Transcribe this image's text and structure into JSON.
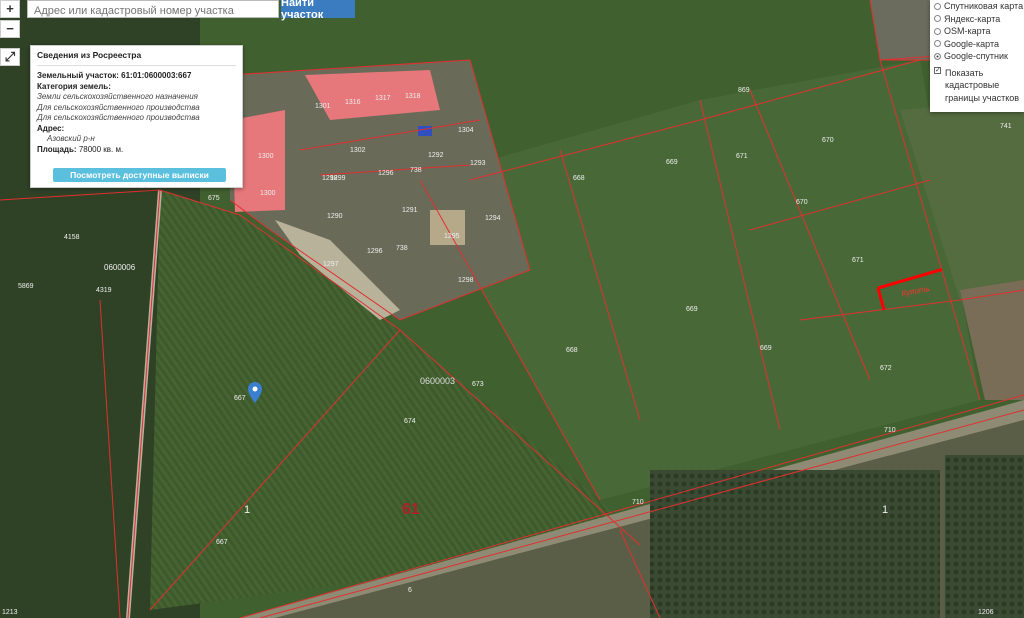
{
  "search": {
    "placeholder": "Адрес или кадастровый номер участка",
    "button": "Найти участок"
  },
  "zoom": {
    "in": "+",
    "out": "−",
    "fullscreen": "⤢"
  },
  "info_panel": {
    "title": "Сведения из Росреестра",
    "parcel_label": "Земельный участок:",
    "parcel_value": "61:01:0600003:667",
    "category_label": "Категория земель:",
    "category_value": "Земли сельскохозяйственного назначения",
    "usage_1": "Для сельскохозяйственного производства",
    "usage_2": "Для сельскохозяйственного производства",
    "address_label": "Адрес:",
    "address_value": "Азовский р-н",
    "area_label": "Площадь:",
    "area_value": "78000 кв. м.",
    "button": "Посмотреть доступные выписки"
  },
  "layers": {
    "options": [
      {
        "label": "Спутниковая карта",
        "selected": false
      },
      {
        "label": "Яндекс-карта",
        "selected": false
      },
      {
        "label": "OSM-карта",
        "selected": false
      },
      {
        "label": "Google-карта",
        "selected": false
      },
      {
        "label": "Google-спутник",
        "selected": true
      }
    ],
    "checkbox_label": "Показать кадастровые границы участков",
    "checkbox_checked": true
  },
  "map_labels": {
    "plots": [
      "1301",
      "1316",
      "1317",
      "1318",
      "1304",
      "1302",
      "1300",
      "1299",
      "1300",
      "1298",
      "1293",
      "1290",
      "1295",
      "1296",
      "1291",
      "1294",
      "1292",
      "738",
      "738",
      "1297",
      "1296",
      "1298",
      "869",
      "670",
      "669",
      "668",
      "670",
      "671",
      "669",
      "668",
      "669",
      "672",
      "673",
      "674",
      "667",
      "667",
      "741",
      "4158",
      "0600006",
      "5869",
      "4319",
      "675",
      "710",
      "710",
      "6",
      "1213",
      "1206",
      "671"
    ],
    "blocks": [
      "0600003",
      "0600006"
    ],
    "region": "61",
    "one_left": "1",
    "one_right": "1",
    "red_note": "Купить"
  },
  "colors": {
    "boundary": "#e03030",
    "highlight": "#ff0000",
    "pin": "#3a7fd0"
  }
}
